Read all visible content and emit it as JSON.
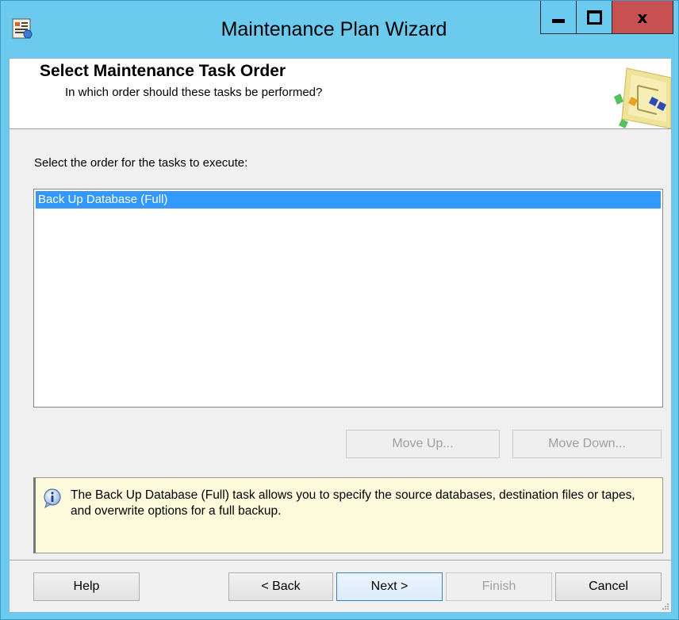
{
  "window": {
    "title": "Maintenance Plan Wizard",
    "controls": {
      "minimize": "minimize-icon",
      "maximize": "maximize-icon",
      "close": "x"
    }
  },
  "header": {
    "title": "Select Maintenance Task Order",
    "subtitle": "In which order should these tasks be performed?"
  },
  "main": {
    "order_label": "Select the order for the tasks to execute:",
    "tasks": [
      "Back Up Database (Full)"
    ],
    "move_up_label": "Move Up...",
    "move_down_label": "Move Down...",
    "info_text": "The Back Up Database (Full) task allows you to specify the source databases, destination files or tapes, and overwrite options for a full backup."
  },
  "footer": {
    "help_label": "Help",
    "back_label": "< Back",
    "next_label": "Next >",
    "finish_label": "Finish",
    "cancel_label": "Cancel"
  },
  "colors": {
    "titlebar": "#6ccaee",
    "close_button": "#c75050",
    "selection": "#3399ff",
    "info_background": "#fcfcdc"
  }
}
